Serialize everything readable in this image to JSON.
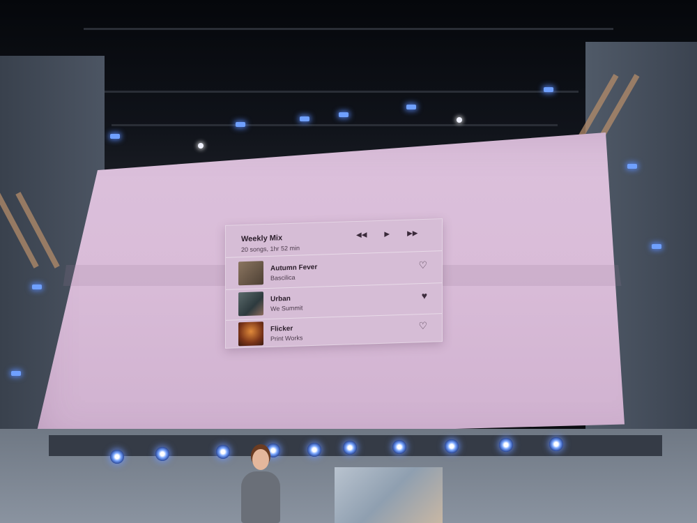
{
  "player": {
    "title": "Weekly Mix",
    "subtitle": "20 songs, 1hr 52 min",
    "controls": {
      "rewind": "◀◀",
      "play": "▶",
      "forward": "▶▶"
    },
    "songs": [
      {
        "title": "Autumn Fever",
        "artist": "Bascilica",
        "heart": "♡",
        "liked": false,
        "thumb_color": "#6b5a4a"
      },
      {
        "title": "Urban",
        "artist": "We Summit",
        "heart": "♥",
        "liked": true,
        "thumb_color": "#3f5055"
      },
      {
        "title": "Flicker",
        "artist": "Print Works",
        "heart": "♡",
        "liked": false,
        "thumb_color": "#8a4a2a"
      }
    ]
  },
  "colors": {
    "screen": "#dcc1dc",
    "stage_lights": "#6fa0ff"
  }
}
